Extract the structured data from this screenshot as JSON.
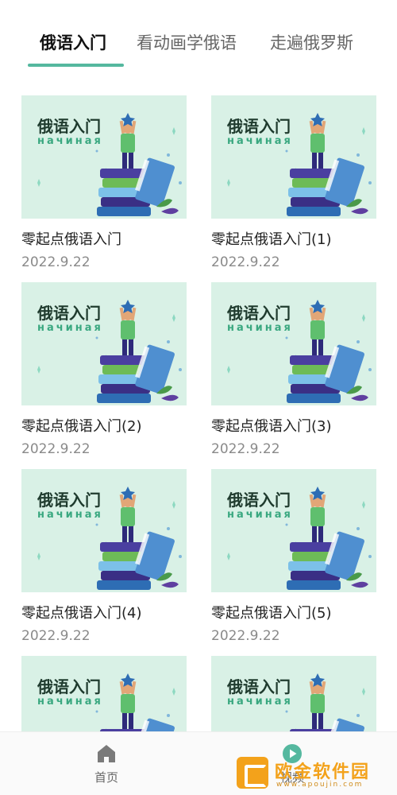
{
  "tabs": [
    {
      "label": "俄语入门",
      "active": true
    },
    {
      "label": "看动画学俄语",
      "active": false
    },
    {
      "label": "走遍俄罗斯",
      "active": false
    }
  ],
  "cards": [
    {
      "thumb_title": "俄语入门",
      "thumb_subtitle": "начиная",
      "title": "零起点俄语入门",
      "date": "2022.9.22"
    },
    {
      "thumb_title": "俄语入门",
      "thumb_subtitle": "начиная",
      "title": "零起点俄语入门(1)",
      "date": "2022.9.22"
    },
    {
      "thumb_title": "俄语入门",
      "thumb_subtitle": "начиная",
      "title": "零起点俄语入门(2)",
      "date": "2022.9.22"
    },
    {
      "thumb_title": "俄语入门",
      "thumb_subtitle": "начиная",
      "title": "零起点俄语入门(3)",
      "date": "2022.9.22"
    },
    {
      "thumb_title": "俄语入门",
      "thumb_subtitle": "начиная",
      "title": "零起点俄语入门(4)",
      "date": "2022.9.22"
    },
    {
      "thumb_title": "俄语入门",
      "thumb_subtitle": "начиная",
      "title": "零起点俄语入门(5)",
      "date": "2022.9.22"
    },
    {
      "thumb_title": "俄语入门",
      "thumb_subtitle": "начиная"
    },
    {
      "thumb_title": "俄语入门",
      "thumb_subtitle": "начиная"
    }
  ],
  "bottom_nav": {
    "items": [
      {
        "label": "首页",
        "icon": "home-icon"
      },
      {
        "label": "视频",
        "icon": "play-icon"
      }
    ]
  },
  "watermark": {
    "text": "欧金软件园",
    "subtext": "www.apoujin.com"
  },
  "colors": {
    "accent": "#55b89f",
    "thumb_bg": "#d9f1e6",
    "watermark": "#f3a21b"
  }
}
